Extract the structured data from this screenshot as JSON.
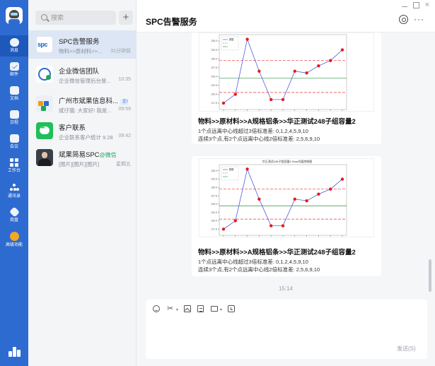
{
  "rail": {
    "items": [
      {
        "label": "消息",
        "icon": "chat-bubble-icon"
      },
      {
        "label": "邮件",
        "icon": "mail-icon"
      },
      {
        "label": "文档",
        "icon": "document-icon"
      },
      {
        "label": "日程",
        "icon": "calendar-icon"
      },
      {
        "label": "会议",
        "icon": "meeting-icon"
      },
      {
        "label": "工作台",
        "icon": "workbench-icon"
      },
      {
        "label": "通讯录",
        "icon": "contacts-icon"
      },
      {
        "label": "商盘",
        "icon": "hexagon-icon"
      },
      {
        "label": "高级功能",
        "icon": "premium-icon"
      }
    ]
  },
  "list": {
    "search_placeholder": "搜索",
    "conversations": [
      {
        "name": "SPC告警服务",
        "preview": "物料>>原材料>>...",
        "time": "31分钟前",
        "avatar": "spc-logo",
        "avatar_text": "spc"
      },
      {
        "name": "企业微信团队",
        "preview": "企业微信管理后台登...",
        "time": "10:35",
        "avatar": "health-team-logo"
      },
      {
        "name": "广州市斌果信息科...",
        "tag": "企业",
        "preview": "斌仔猫: 大家好! 我是...",
        "time": "09:59",
        "avatar": "company-logo"
      },
      {
        "name": "客户联系",
        "preview": "企业联系客户统计 9.28",
        "time": "09:42",
        "avatar": "customer-contact-logo"
      },
      {
        "name": "斌果简易SPC",
        "tag_green": "@微信",
        "preview": "[图片][图片][图片]",
        "time": "星期五",
        "avatar": "person-avatar"
      }
    ]
  },
  "header": {
    "title": "SPC告警服务"
  },
  "messages": [
    {
      "chart_title": "",
      "title": "物料>>原材料>>A规格铝条>>华正测试248子组容量2",
      "line1": "1个点远离中心线超过3倍标准差: 0,1,2,4,5,9,10",
      "line2": "连续3个点,有2个点远离中心线2倍标准差: 2,5,6,9,10"
    },
    {
      "chart_title": "华正测试248子组容量2 Xbar均值控制图",
      "title": "物料>>原材料>>A规格铝条>>华正测试248子组容量2",
      "line1": "1个点远离中心线超过3倍标准差: 0,1,2,4,5,9,10",
      "line2": "连续3个点,有2个点远离中心线2倍标准差: 2,5,6,9,10"
    }
  ],
  "timestamp": "15:14",
  "composer": {
    "send_label": "发送(S)"
  },
  "chart_data": {
    "type": "line",
    "x": [
      0,
      1,
      2,
      3,
      4,
      5,
      6,
      7,
      8,
      9,
      10
    ],
    "series": [
      {
        "name": "数据",
        "values": [
          217.5,
          220.0,
          235.5,
          226.5,
          218.5,
          218.5,
          226.5,
          226.0,
          228.0,
          229.5,
          232.5
        ],
        "color": "#3b4ad8"
      }
    ],
    "limits": {
      "ucl": 229.5,
      "cl": 224.5,
      "lcl": 220.5
    },
    "ylim": [
      216.5,
      236.0
    ],
    "legend": "top-left",
    "colors": {
      "ucl": "#e53935",
      "cl": "#2e8b3c",
      "lcl": "#e53935",
      "points": "#e81919"
    }
  }
}
